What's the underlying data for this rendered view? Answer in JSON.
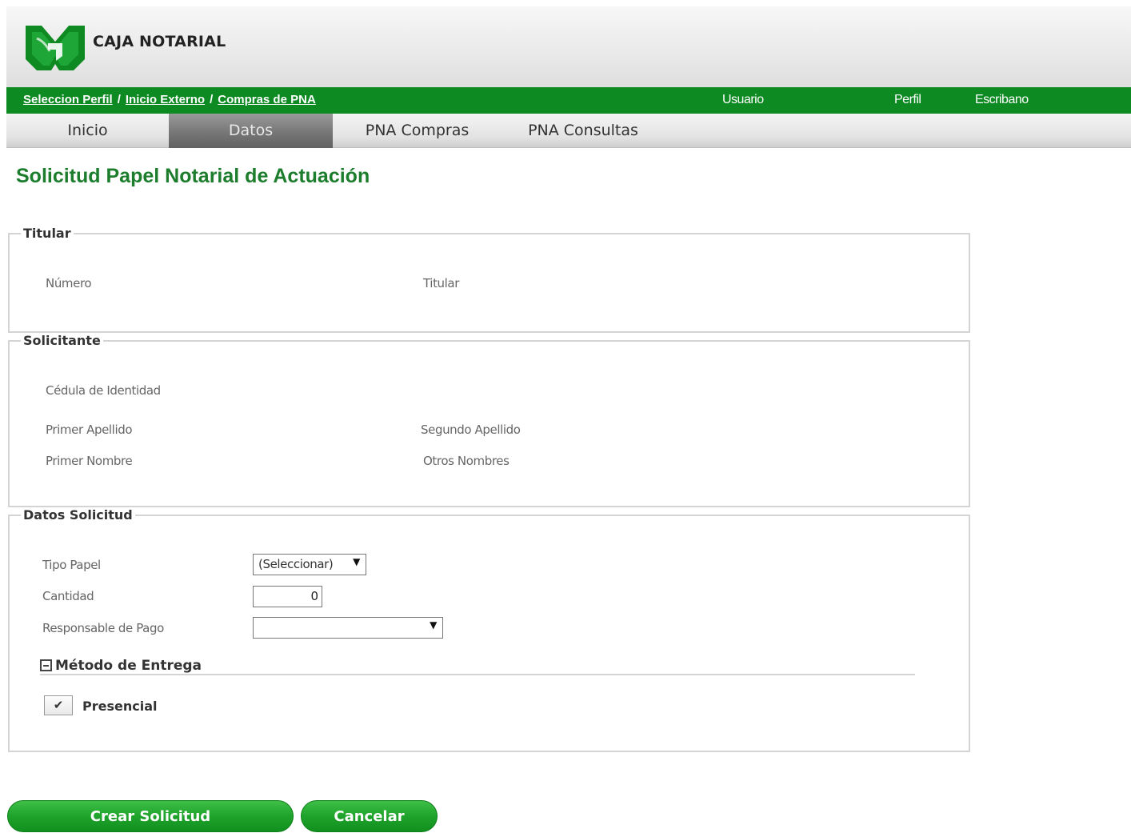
{
  "header": {
    "brand": "CAJA NOTARIAL"
  },
  "breadcrumb": {
    "items": [
      "Seleccion Perfil",
      "Inicio Externo",
      "Compras de PNA"
    ],
    "separator": "/"
  },
  "user_bar": {
    "usuario_label": "Usuario",
    "perfil_label": "Perfil",
    "perfil_value": "Escribano"
  },
  "nav": {
    "tabs": [
      {
        "label": "Inicio",
        "active": false
      },
      {
        "label": "Datos",
        "active": true
      },
      {
        "label": "PNA Compras",
        "active": false
      },
      {
        "label": "PNA Consultas",
        "active": false
      }
    ]
  },
  "page": {
    "title": "Solicitud Papel Notarial de Actuación"
  },
  "titular": {
    "legend": "Titular",
    "numero_label": "Número",
    "titular_label": "Titular"
  },
  "solicitante": {
    "legend": "Solicitante",
    "cedula_label": "Cédula de Identidad",
    "primer_apellido_label": "Primer Apellido",
    "segundo_apellido_label": "Segundo Apellido",
    "primer_nombre_label": "Primer Nombre",
    "otros_nombres_label": "Otros Nombres"
  },
  "datos_solicitud": {
    "legend": "Datos Solicitud",
    "tipo_papel_label": "Tipo Papel",
    "tipo_papel_value": "(Seleccionar)",
    "cantidad_label": "Cantidad",
    "cantidad_value": "0",
    "responsable_label": "Responsable de Pago",
    "responsable_value": "",
    "metodo_entrega_label": "Método de Entrega",
    "presencial_label": "Presencial",
    "presencial_checked": true
  },
  "actions": {
    "crear_label": "Crear Solicitud",
    "cancelar_label": "Cancelar"
  },
  "colors": {
    "brand_green": "#0d8a22",
    "title_green": "#1c7d2c",
    "button_green": "#1ea32b"
  },
  "icons": {
    "logo": "caja-notarial-logo",
    "dropdown": "triangle-down-icon",
    "collapse": "minus-box-icon",
    "checkmark": "check-icon"
  }
}
